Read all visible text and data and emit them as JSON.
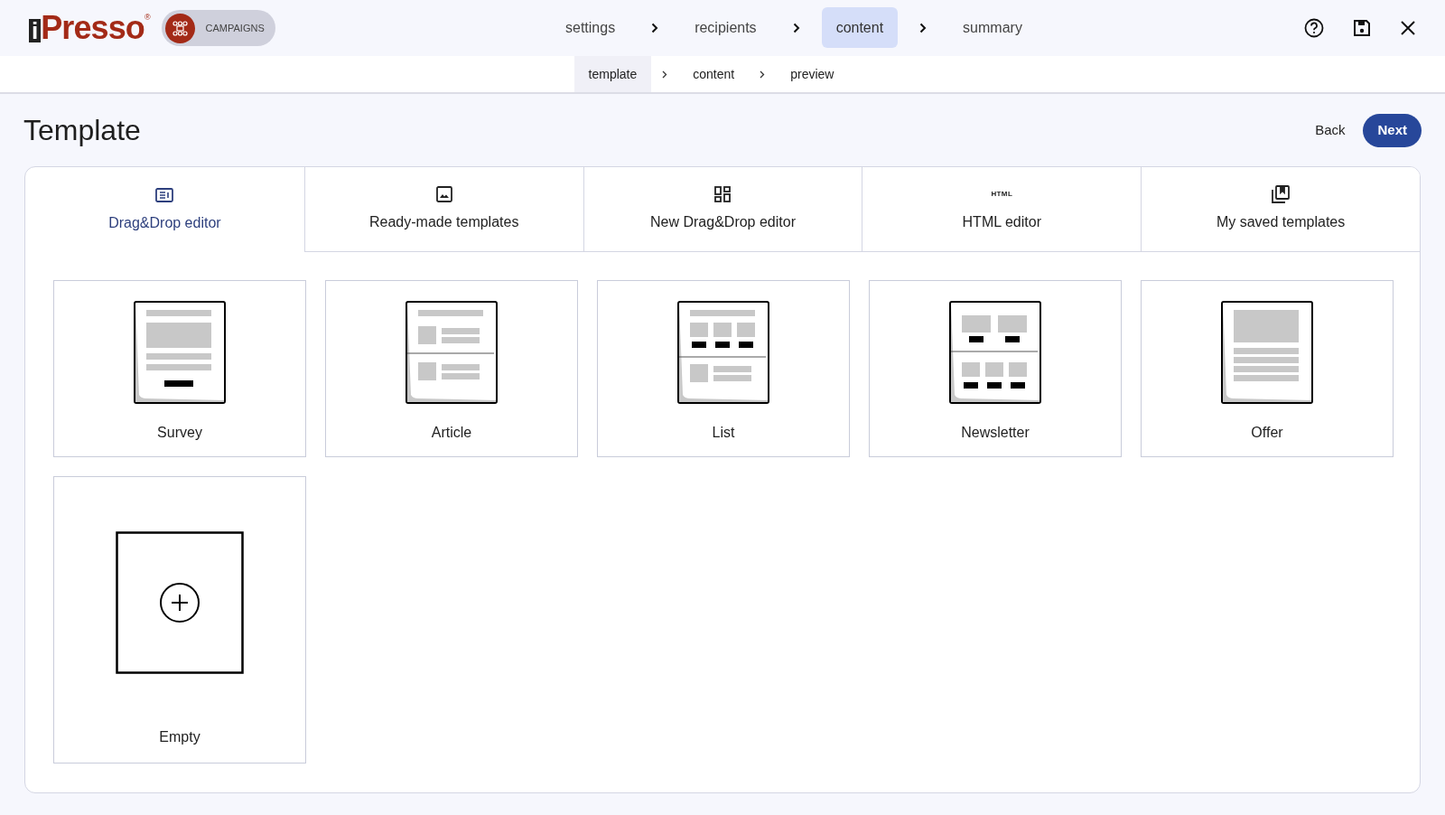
{
  "logo": {
    "mark": "i",
    "text": "Presso",
    "registered": "®"
  },
  "module_badge": {
    "label": "CAMPAIGNS"
  },
  "steps": [
    {
      "label": "settings",
      "selected": false
    },
    {
      "label": "recipients",
      "selected": false
    },
    {
      "label": "content",
      "selected": true
    },
    {
      "label": "summary",
      "selected": false
    }
  ],
  "substeps": [
    {
      "label": "template",
      "selected": true
    },
    {
      "label": "content",
      "selected": false
    },
    {
      "label": "preview",
      "selected": false
    }
  ],
  "page_title": "Template",
  "actions": {
    "back": "Back",
    "next": "Next"
  },
  "tabs": [
    {
      "kind": "dragdrop",
      "label": "Drag&Drop editor",
      "selected": true
    },
    {
      "kind": "image",
      "label": "Ready-made templates",
      "selected": false
    },
    {
      "kind": "grid",
      "label": "New Drag&Drop editor",
      "selected": false
    },
    {
      "kind": "html",
      "icon_text": "HTML",
      "label": "HTML editor",
      "selected": false
    },
    {
      "kind": "saved",
      "label": "My saved templates",
      "selected": false
    }
  ],
  "templates": [
    {
      "kind": "survey",
      "label": "Survey"
    },
    {
      "kind": "article",
      "label": "Article"
    },
    {
      "kind": "list",
      "label": "List"
    },
    {
      "kind": "newsletter",
      "label": "Newsletter"
    },
    {
      "kind": "offer",
      "label": "Offer"
    },
    {
      "kind": "empty",
      "label": "Empty"
    }
  ]
}
